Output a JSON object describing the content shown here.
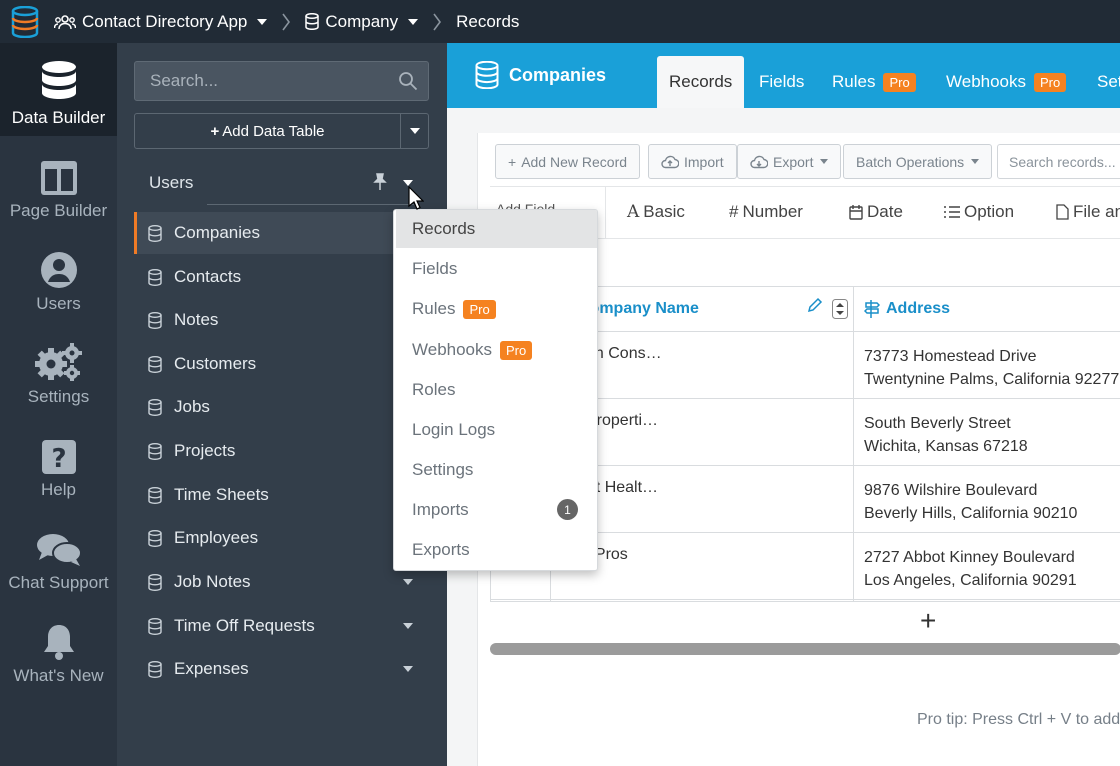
{
  "topbar": {
    "app_name": "Contact Directory App",
    "section": "Company",
    "page": "Records"
  },
  "leftnav": [
    {
      "label": "Data Builder",
      "icon": "database-icon"
    },
    {
      "label": "Page Builder",
      "icon": "page-builder-icon"
    },
    {
      "label": "Users",
      "icon": "user-icon"
    },
    {
      "label": "Settings",
      "icon": "gears-icon"
    },
    {
      "label": "Help",
      "icon": "help-icon"
    },
    {
      "label": "Chat Support",
      "icon": "chat-icon"
    },
    {
      "label": "What's New",
      "icon": "bell-icon"
    }
  ],
  "sidebar": {
    "search_placeholder": "Search...",
    "add_data_table": "Add Data Table",
    "users_label": "Users",
    "tables": [
      "Companies",
      "Contacts",
      "Notes",
      "Customers",
      "Jobs",
      "Projects",
      "Time Sheets",
      "Employees",
      "Job Notes",
      "Time Off Requests",
      "Expenses"
    ]
  },
  "header": {
    "title": "Companies",
    "tabs": [
      {
        "label": "Records",
        "pro": ""
      },
      {
        "label": "Fields",
        "pro": ""
      },
      {
        "label": "Rules",
        "pro": "Pro"
      },
      {
        "label": "Webhooks",
        "pro": "Pro"
      },
      {
        "label": "Set",
        "pro": ""
      }
    ]
  },
  "toolbar": {
    "add_record": "Add New Record",
    "import": "Import",
    "export": "Export",
    "batch": "Batch Operations",
    "search_placeholder": "Search records..."
  },
  "field_types": {
    "add_field": "Add Field",
    "types": [
      "Basic",
      "Number",
      "Date",
      "Option",
      "File an"
    ]
  },
  "grid": {
    "columns": [
      "Company Name",
      "Address"
    ],
    "rows": [
      {
        "name": "son Cons…",
        "addr1": "73773 Homestead Drive",
        "addr2": "Twentynine Palms, California 92277"
      },
      {
        "name": "l Properti…",
        "addr1": "South Beverly Street",
        "addr2": "Wichita, Kansas 67218"
      },
      {
        "name": "ght Healt…",
        "addr1": "9876 Wilshire Boulevard",
        "addr2": "Beverly Hills, California 90210"
      },
      {
        "name": "al Pros",
        "addr1": "2727 Abbot Kinney Boulevard",
        "addr2": "Los Angeles, California 90291"
      }
    ],
    "add_row": "+"
  },
  "protip": "Pro tip: Press Ctrl + V to add",
  "menu": {
    "items": [
      {
        "label": "Records",
        "pro": "",
        "badge": ""
      },
      {
        "label": "Fields",
        "pro": "",
        "badge": ""
      },
      {
        "label": "Rules",
        "pro": "Pro",
        "badge": ""
      },
      {
        "label": "Webhooks",
        "pro": "Pro",
        "badge": ""
      },
      {
        "label": "Roles",
        "pro": "",
        "badge": ""
      },
      {
        "label": "Login Logs",
        "pro": "",
        "badge": ""
      },
      {
        "label": "Settings",
        "pro": "",
        "badge": ""
      },
      {
        "label": "Imports",
        "pro": "",
        "badge": "1"
      },
      {
        "label": "Exports",
        "pro": "",
        "badge": ""
      }
    ]
  },
  "colors": {
    "accent": "#1aa0d8",
    "pro_badge": "#f58220",
    "active_indicator": "#f07b26"
  }
}
